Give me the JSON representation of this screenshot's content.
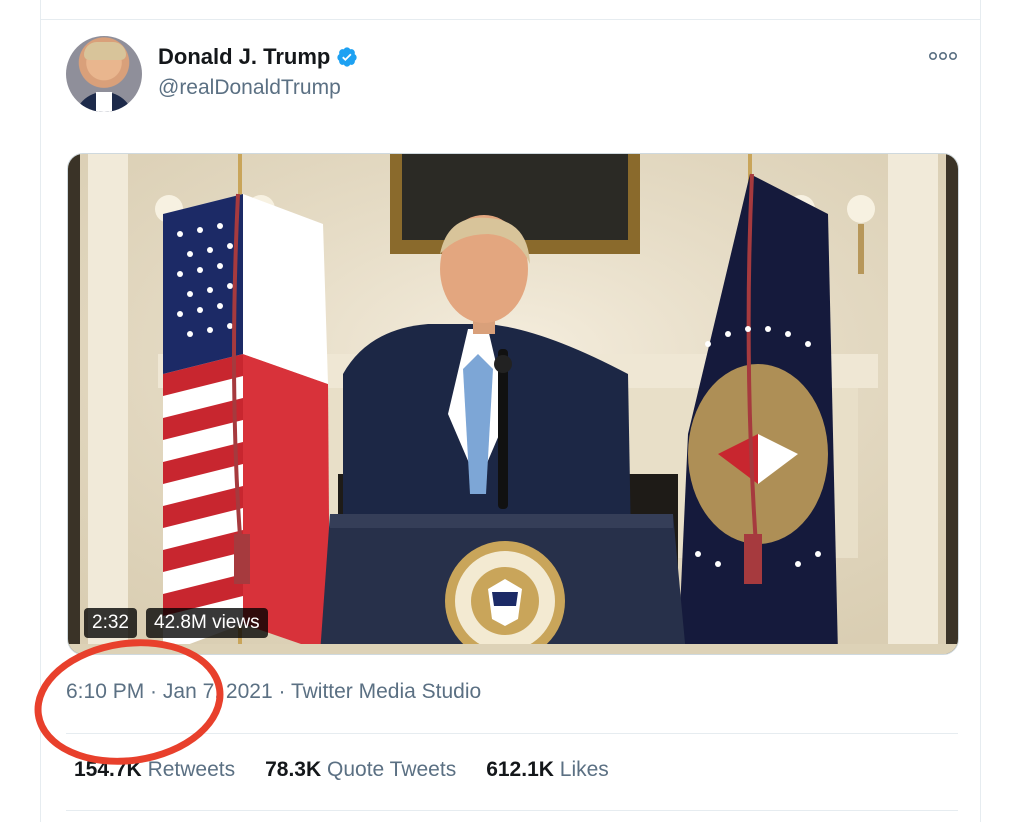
{
  "tweet": {
    "display_name": "Donald J. Trump",
    "handle": "@realDonaldTrump",
    "verified": true,
    "more_icon": "more-horizontal-icon",
    "media": {
      "duration": "2:32",
      "views": "42.8M views"
    },
    "time": "6:10 PM",
    "separator": " · ",
    "date": "Jan 7, 2021",
    "source": "Twitter Media Studio",
    "stats": {
      "retweets_count": "154.7K",
      "retweets_label": "Retweets",
      "quote_count": "78.3K",
      "quote_label": "Quote Tweets",
      "likes_count": "612.1K",
      "likes_label": "Likes"
    }
  },
  "colors": {
    "verified_blue": "#1da1f2",
    "annotation_red": "#e8402c",
    "secondary_text": "#5b7083"
  }
}
